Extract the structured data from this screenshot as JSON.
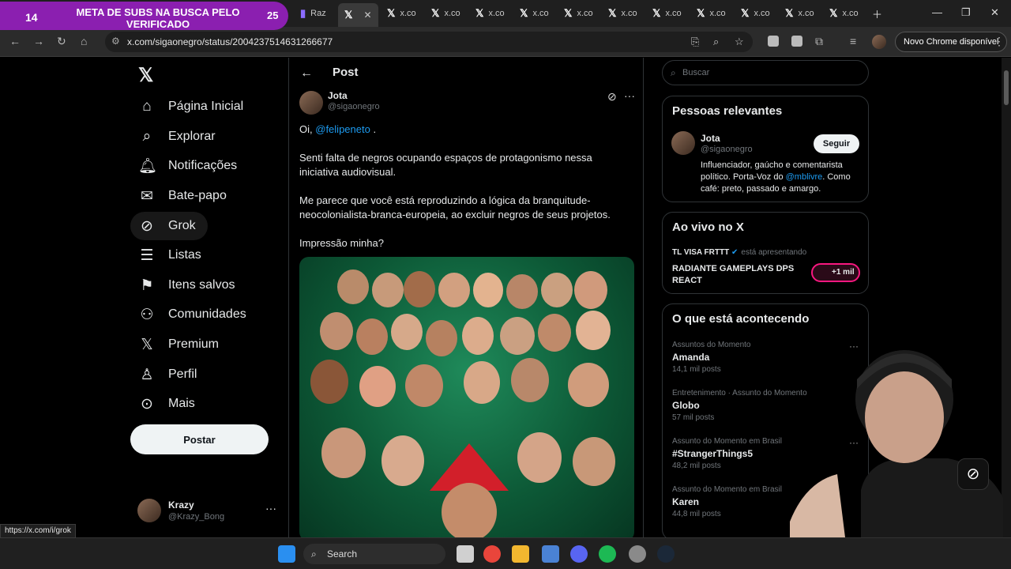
{
  "overlay": {
    "count": "14",
    "text": "META DE SUBS NA BUSCA PELO VERIFICADO",
    "badge": "25"
  },
  "tabs": [
    {
      "label": "Raz"
    },
    {
      "label": "x.co"
    },
    {
      "label": "x.co"
    },
    {
      "label": "x.co"
    },
    {
      "label": "x.co"
    },
    {
      "label": "x.co"
    },
    {
      "label": "x.co"
    },
    {
      "label": "x.co"
    },
    {
      "label": "x.co"
    },
    {
      "label": "x.co"
    },
    {
      "label": "x.co"
    },
    {
      "label": "x.co"
    }
  ],
  "browser": {
    "url": "x.com/sigaonegro/status/2004237514631266677",
    "update_label": "Novo Chrome disponível",
    "status_url": "https://x.com/i/grok"
  },
  "nav": {
    "items": [
      {
        "label": "Página Inicial",
        "icon": "home-icon"
      },
      {
        "label": "Explorar",
        "icon": "search-icon"
      },
      {
        "label": "Notificações",
        "icon": "bell-icon"
      },
      {
        "label": "Bate-papo",
        "icon": "mail-icon"
      },
      {
        "label": "Grok",
        "icon": "grok-icon"
      },
      {
        "label": "Listas",
        "icon": "list-icon"
      },
      {
        "label": "Itens salvos",
        "icon": "bookmark-icon"
      },
      {
        "label": "Comunidades",
        "icon": "communities-icon"
      },
      {
        "label": "Premium",
        "icon": "x-icon"
      },
      {
        "label": "Perfil",
        "icon": "person-icon"
      },
      {
        "label": "Mais",
        "icon": "more-icon"
      }
    ],
    "post_button": "Postar",
    "account": {
      "name": "Krazy",
      "handle": "@Krazy_Bong"
    }
  },
  "post": {
    "header": "Post",
    "author": {
      "name": "Jota",
      "handle": "@sigaonegro"
    },
    "greeting": "Oi,",
    "mention": "@felipeneto",
    "greeting_end": " .",
    "p1": "Senti falta de negros ocupando espaços de protagonismo nessa iniciativa audiovisual.",
    "p2": "Me parece que você está reproduzindo a lógica da branquitude-neocolonialista-branca-europeia, ao excluir negros de seus projetos.",
    "p3": "Impressão minha?"
  },
  "sidebar": {
    "search_placeholder": "Buscar",
    "relevant": {
      "title": "Pessoas relevantes",
      "name": "Jota",
      "handle": "@sigaonegro",
      "bio_before": "Influenciador, gaúcho e comentarista político. Porta-Voz do ",
      "bio_mention": "@mblivre",
      "bio_after": ". Como café: preto, passado e amargo.",
      "follow_label": "Seguir"
    },
    "live": {
      "title": "Ao vivo no X",
      "host": "TL VISA FRTTT",
      "presenting": "está apresentando",
      "space_name": "RADIANTE GAMEPLAYS DPS REACT",
      "listeners": "+1 mil"
    },
    "trending": {
      "title": "O que está acontecendo",
      "items": [
        {
          "context": "Assuntos do Momento",
          "name": "Amanda",
          "count": "14,1 mil posts"
        },
        {
          "context": "Entretenimento · Assunto do Momento",
          "name": "Globo",
          "count": "57 mil posts"
        },
        {
          "context": "Assunto do Momento em Brasil",
          "name": "#StrangerThings5",
          "count": "48,2 mil posts"
        },
        {
          "context": "Assunto do Momento em Brasil",
          "name": "Karen",
          "count": "44,8 mil posts"
        }
      ]
    }
  },
  "taskbar": {
    "search_label": "Search"
  },
  "colors": {
    "accent": "#1d9bf0",
    "overlay": "#8b1fb0",
    "live_ring": "#f91880"
  }
}
